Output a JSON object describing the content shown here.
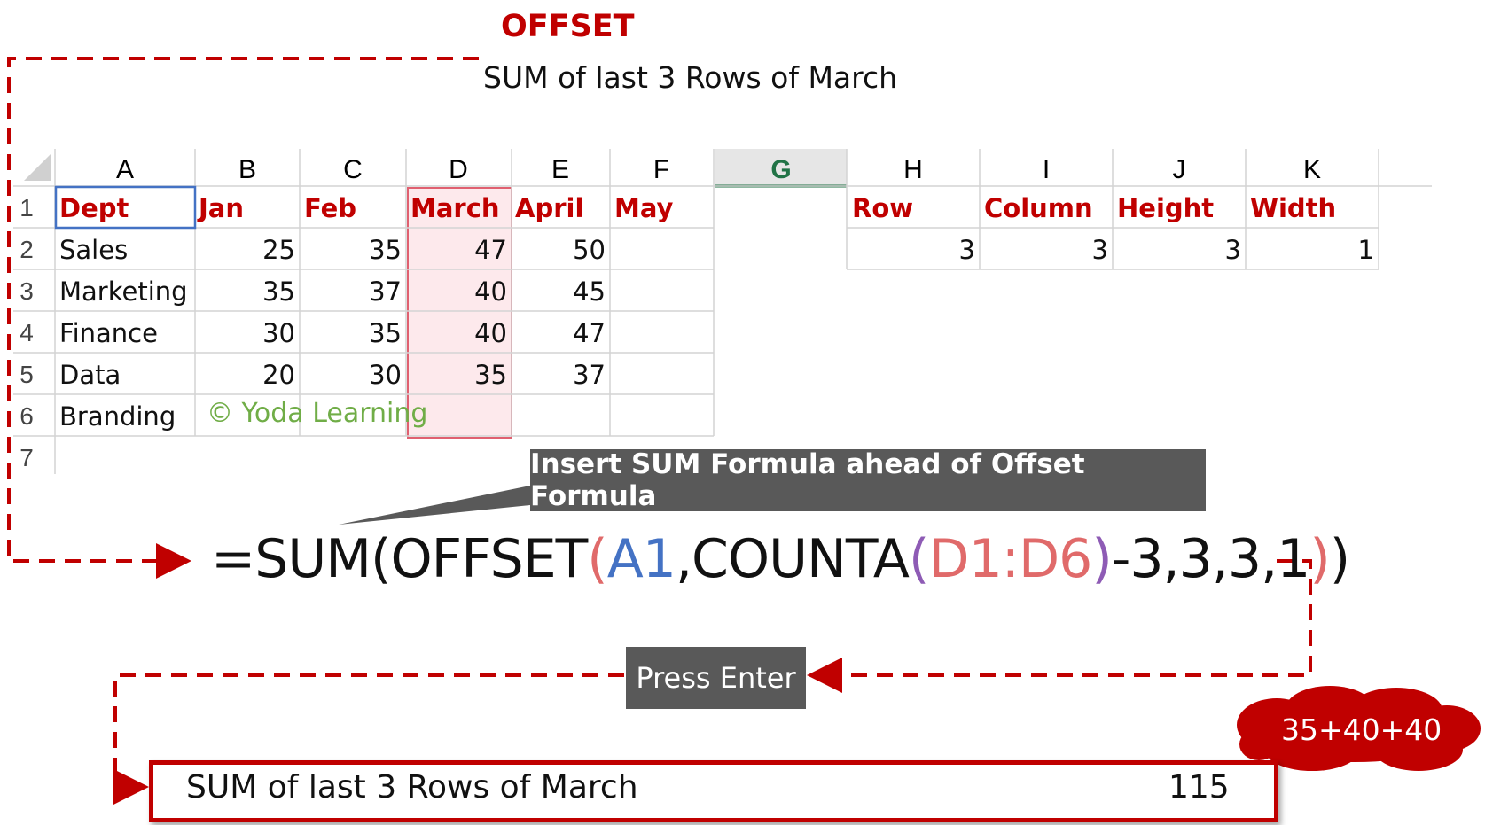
{
  "title": "OFFSET",
  "subtitle": "SUM of last 3 Rows of March",
  "sheet": {
    "columns": [
      "A",
      "B",
      "C",
      "D",
      "E",
      "F",
      "G",
      "H",
      "I",
      "J",
      "K"
    ],
    "selected_column": "G",
    "row_numbers": [
      "1",
      "2",
      "3",
      "4",
      "5",
      "6",
      "7"
    ],
    "header_row": [
      "Dept",
      "Jan",
      "Feb",
      "March",
      "April",
      "May"
    ],
    "rows": [
      {
        "dept": "Sales",
        "values": [
          "25",
          "35",
          "47",
          "50"
        ]
      },
      {
        "dept": "Marketing",
        "values": [
          "35",
          "37",
          "40",
          "45"
        ]
      },
      {
        "dept": "Finance",
        "values": [
          "30",
          "35",
          "40",
          "47"
        ]
      },
      {
        "dept": "Data",
        "values": [
          "20",
          "30",
          "35",
          "37"
        ]
      },
      {
        "dept": "Branding",
        "values": []
      }
    ],
    "params_headers": [
      "Row",
      "Column",
      "Height",
      "Width"
    ],
    "params_values": [
      "3",
      "3",
      "3",
      "1"
    ],
    "watermark": "© Yoda Learning"
  },
  "callout": "Insert SUM Formula ahead of Offset Formula",
  "formula": {
    "p1": "=SUM(OFFSET",
    "p2": "(",
    "p3": "A1",
    "p4": ",COUNTA",
    "p5": "(",
    "p6": "D1:D6",
    "p7": ")",
    "p8": "-3,3,3,1",
    "p9": ")",
    "p10": ")"
  },
  "press_enter": "Press Enter",
  "result": {
    "label": "SUM of last 3 Rows of March",
    "value": "115"
  },
  "cloud": "35+40+40",
  "colors": {
    "accent": "#c00000",
    "highlight": "#fde9ec",
    "callout_bg": "#595959",
    "watermark": "#70ad47",
    "selected_header": "#217346"
  }
}
